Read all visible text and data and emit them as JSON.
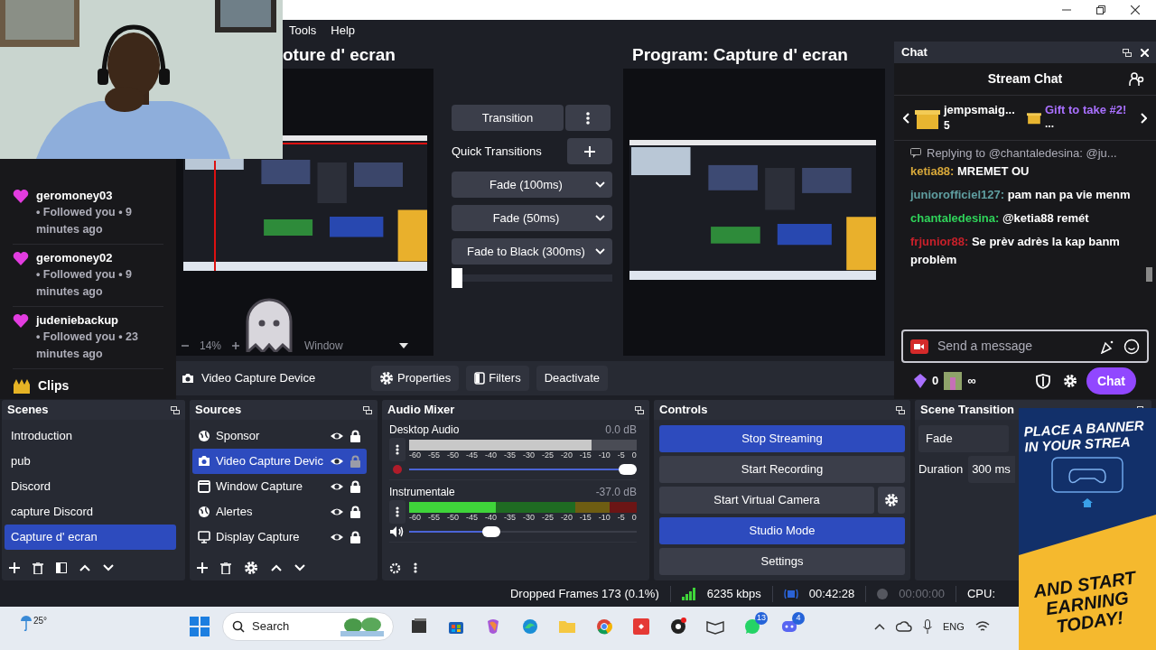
{
  "menu": [
    {
      "label": "Tools"
    },
    {
      "label": "Help"
    }
  ],
  "activity_feed": {
    "items": [
      {
        "user": "geromoney03",
        "text": "• Followed you • 9 minutes ago"
      },
      {
        "user": "geromoney02",
        "text": "• Followed you • 9 minutes ago"
      },
      {
        "user": "judeniebackup",
        "text": "• Followed you • 23 minutes ago"
      }
    ],
    "section": "Clips"
  },
  "preview": {
    "title": "oture d' ecran",
    "zoom": "14%",
    "mode": "Window"
  },
  "transitions": {
    "button": "Transition",
    "label": "Quick Transitions",
    "quick": [
      "Fade (100ms)",
      "Fade (50ms)",
      "Fade to Black (300ms)"
    ],
    "tbar": {
      "level": 0
    }
  },
  "program": {
    "title": "Program: Capture d' ecran"
  },
  "chat": {
    "title": "Chat",
    "heading": "Stream Chat",
    "gifts": [
      {
        "name": "jempsmaig...",
        "count": "5"
      },
      {
        "name": "Gift to take #2!",
        "count": "..."
      }
    ],
    "messages": [
      {
        "reply": "Replying to @chantaledesina: @ju...",
        "user": "ketia88:",
        "color": "#d9a93a",
        "text": "MREMET OU"
      },
      {
        "user": "juniorofficiel127:",
        "color": "#5f9ea0",
        "text": "pam nan pa vie menm"
      },
      {
        "user": "chantaledesina:",
        "color": "#2fd35a",
        "text": "@ketia88  remét"
      },
      {
        "user": "frjunior88:",
        "color": "#c8202a",
        "text": "Se prèv adrès la kap banm problèm"
      }
    ],
    "placeholder": "Send a message",
    "points": "0",
    "badge_count": "∞",
    "send": "Chat"
  },
  "source_toolbar": {
    "source": "Video Capture Device",
    "buttons": [
      {
        "kind": "gear",
        "label": "Properties"
      },
      {
        "kind": "filter",
        "label": "Filters"
      },
      {
        "kind": "plain",
        "label": "Deactivate"
      }
    ]
  },
  "scenes": {
    "title": "Scenes",
    "items": [
      {
        "label": "Introduction",
        "selected": false
      },
      {
        "label": "pub",
        "selected": false
      },
      {
        "label": "Discord",
        "selected": false
      },
      {
        "label": "capture Discord",
        "selected": false
      },
      {
        "label": "Capture d' ecran",
        "selected": true
      }
    ]
  },
  "sources": {
    "title": "Sources",
    "items": [
      {
        "label": "Sponsor",
        "kind": "globe",
        "visible": true,
        "locked": true,
        "selected": false
      },
      {
        "label": "Video Capture Devic",
        "kind": "camera",
        "visible": true,
        "locked": false,
        "selected": true
      },
      {
        "label": "Window Capture",
        "kind": "window",
        "visible": true,
        "locked": true,
        "selected": false
      },
      {
        "label": "Alertes",
        "kind": "globe",
        "visible": true,
        "locked": true,
        "selected": false
      },
      {
        "label": "Display Capture",
        "kind": "monitor",
        "visible": true,
        "locked": true,
        "selected": false
      }
    ]
  },
  "audio_mixer": {
    "title": "Audio Mixer",
    "channels": [
      {
        "name": "Desktop Audio",
        "reading": "0.0 dB",
        "muted": true,
        "meter": {
          "level": 0.8
        },
        "fader": {
          "level": 1
        },
        "scale": [
          "-60",
          "-55",
          "-50",
          "-45",
          "-40",
          "-35",
          "-30",
          "-25",
          "-20",
          "-15",
          "-10",
          "-5",
          "0"
        ]
      },
      {
        "name": "Instrumentale",
        "reading": "-37.0 dB",
        "muted": false,
        "meter": {
          "level": 0.38
        },
        "fader": {
          "level": 0.35
        },
        "scale": [
          "-60",
          "-55",
          "-50",
          "-45",
          "-40",
          "-35",
          "-30",
          "-25",
          "-20",
          "-15",
          "-10",
          "-5",
          "0"
        ]
      }
    ]
  },
  "controls": {
    "title": "Controls",
    "buttons": [
      {
        "label": "Stop Streaming",
        "active": true,
        "settings": false
      },
      {
        "label": "Start Recording",
        "active": false,
        "settings": false
      },
      {
        "label": "Start Virtual Camera",
        "active": false,
        "settings": true
      },
      {
        "label": "Studio Mode",
        "active": true,
        "settings": false
      },
      {
        "label": "Settings",
        "active": false,
        "settings": false
      }
    ]
  },
  "scene_transitions": {
    "title": "Scene Transition",
    "transition": "Fade",
    "duration_label": "Duration",
    "duration": "300 ms"
  },
  "banner": {
    "headline": [
      "PLACE A BANNER",
      "IN YOUR STREA"
    ],
    "cta": [
      "AND START",
      "EARNING",
      "TODAY!"
    ]
  },
  "status_bar": {
    "dropped": "Dropped Frames 173 (0.1%)",
    "bitrate": "6235 kbps",
    "stream_time": "00:42:28",
    "record_time": "00:00:00",
    "cpu": "CPU:"
  },
  "taskbar": {
    "weather": "25°",
    "search": "Search",
    "language": "ENG",
    "apps": [
      {
        "kind": "taskview"
      },
      {
        "kind": "store"
      },
      {
        "kind": "copilot"
      },
      {
        "kind": "edge"
      },
      {
        "kind": "folder"
      },
      {
        "kind": "chrome"
      },
      {
        "kind": "anydesk"
      },
      {
        "kind": "obs"
      },
      {
        "kind": "book"
      },
      {
        "kind": "whatsapp",
        "badge": "13"
      },
      {
        "kind": "discord",
        "badge": "4"
      }
    ]
  }
}
